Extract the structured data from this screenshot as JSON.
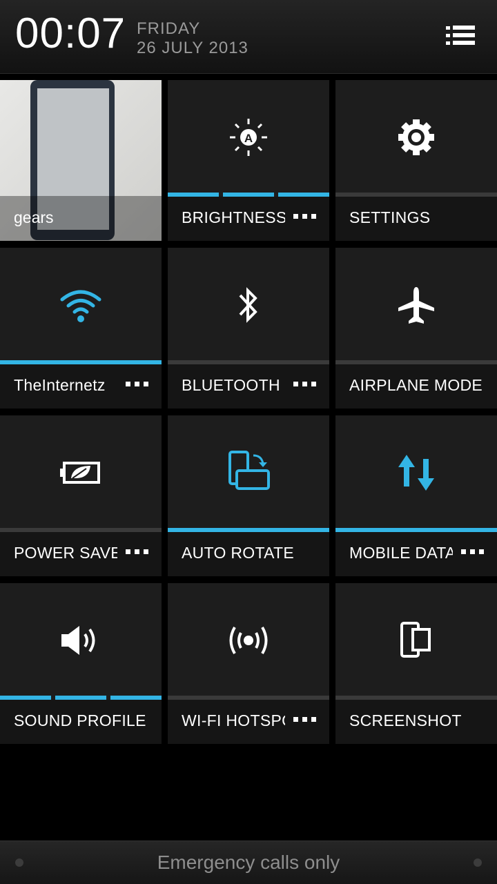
{
  "header": {
    "time": "00:07",
    "day": "FRIDAY",
    "date": "26 JULY 2013"
  },
  "tiles": {
    "gears": {
      "label": "gears"
    },
    "brightness": {
      "label": "BRIGHTNESS"
    },
    "settings": {
      "label": "SETTINGS"
    },
    "wifi": {
      "label": "TheInternetz"
    },
    "bluetooth": {
      "label": "BLUETOOTH"
    },
    "airplane": {
      "label": "AIRPLANE MODE"
    },
    "power_saver": {
      "label": "POWER SAVER"
    },
    "auto_rotate": {
      "label": "AUTO ROTATE"
    },
    "mobile_data": {
      "label": "MOBILE DATA"
    },
    "sound_profile": {
      "label": "SOUND PROFILE"
    },
    "wifi_hotspot": {
      "label": "WI-FI HOTSPOT"
    },
    "screenshot": {
      "label": "SCREENSHOT"
    }
  },
  "status": {
    "text": "Emergency calls only"
  },
  "colors": {
    "accent": "#33b5e5",
    "tile_bg": "#1d1d1d",
    "background": "#000000"
  },
  "icons": [
    "menu-icon",
    "brightness-auto-icon",
    "gear-icon",
    "wifi-icon",
    "bluetooth-icon",
    "airplane-icon",
    "battery-leaf-icon",
    "auto-rotate-icon",
    "mobile-data-icon",
    "speaker-icon",
    "hotspot-icon",
    "screenshot-icon"
  ]
}
